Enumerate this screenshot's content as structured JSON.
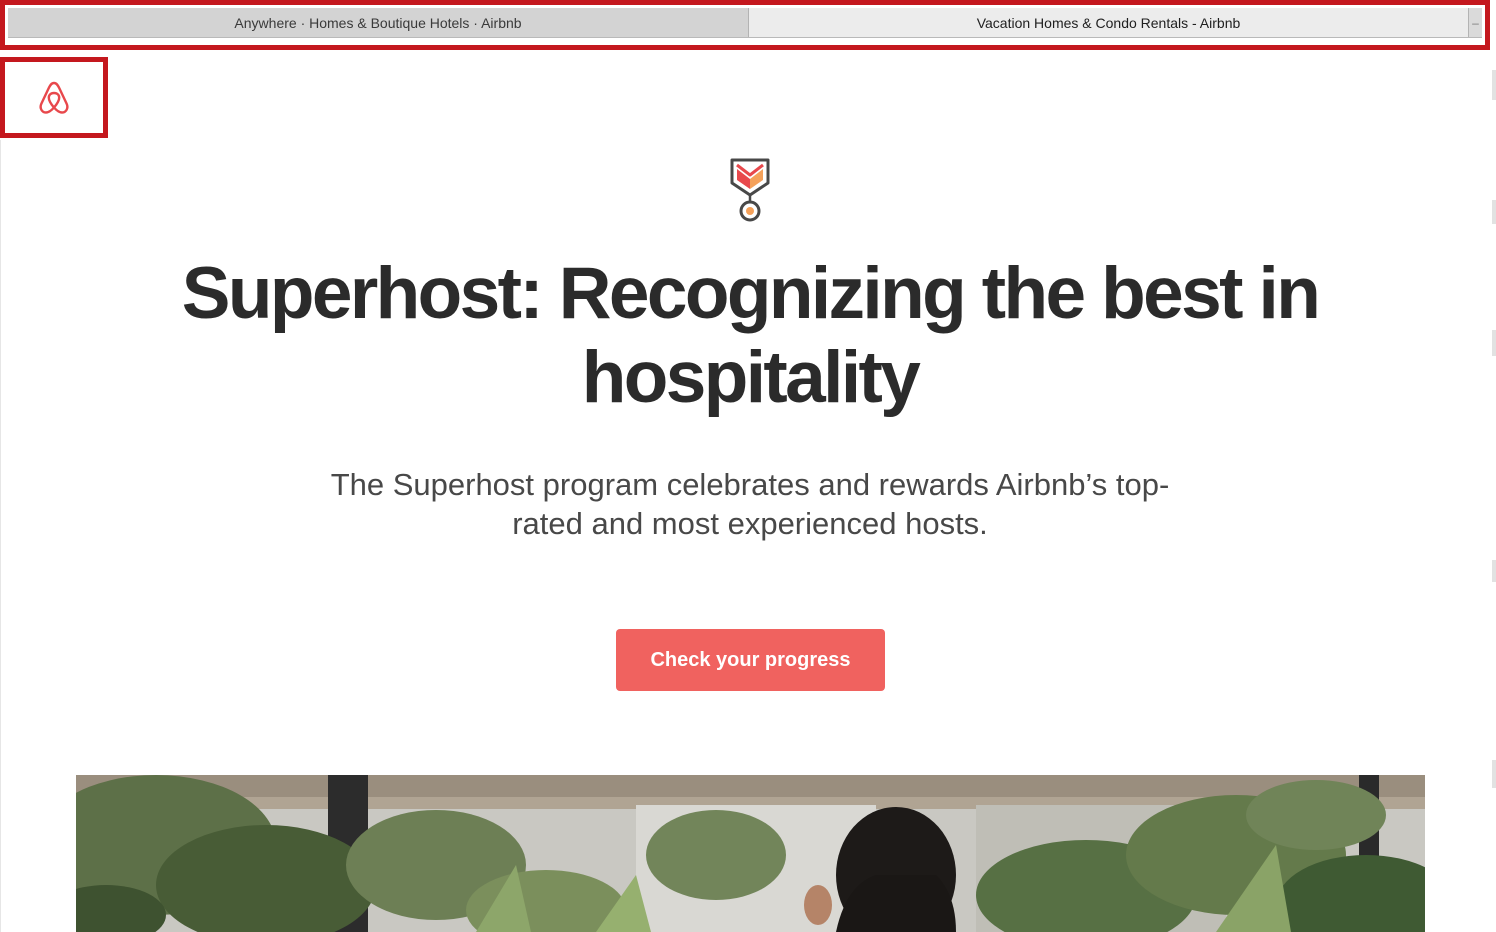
{
  "browser": {
    "tabs": [
      {
        "label": "Anywhere · Homes & Boutique Hotels · Airbnb",
        "active": false
      },
      {
        "label": "Vacation Homes & Condo Rentals - Airbnb",
        "active": true
      }
    ],
    "new_tab_glyph": "–"
  },
  "brand": {
    "logo_icon": "airbnb-belo-icon",
    "accent_color": "#f0625f",
    "logo_color": "#e8484c"
  },
  "hero": {
    "badge_icon": "superhost-medal-icon",
    "title": "Superhost: Recognizing the best in hospitality",
    "subtitle": "The Superhost program celebrates and rewards Airbnb’s top-rated and most experienced hosts.",
    "cta_label": "Check your progress",
    "image_subject": "host-in-garden-photo"
  },
  "annotation_color": "#c4181e"
}
